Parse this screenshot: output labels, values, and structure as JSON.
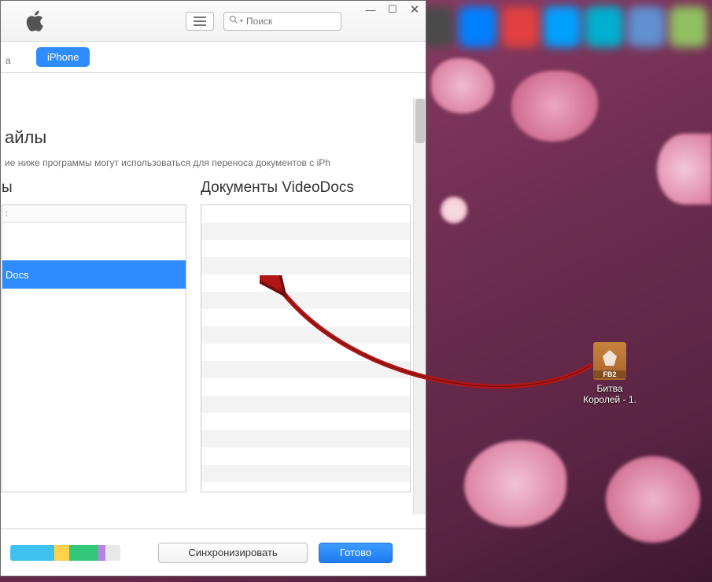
{
  "window": {
    "search_placeholder": "Поиск",
    "controls": {
      "min": "—",
      "max": "☐",
      "close": "✕"
    }
  },
  "breadcrumb_partial": "а",
  "tab": {
    "iphone": "iPhone"
  },
  "section": {
    "title_partial": "айлы",
    "description_partial": "ие ниже программы могут использоваться для переноса документов с iPh"
  },
  "apps_panel": {
    "title_partial": "ы",
    "header_partial": ":",
    "selected_app": "Docs"
  },
  "docs_panel": {
    "title": "Документы VideoDocs"
  },
  "buttons": {
    "sync": "Синхронизировать",
    "done": "Готово"
  },
  "desktop_file": {
    "badge": "FB2",
    "name": "Битва\nКоролей - 1."
  },
  "colors": {
    "accent_blue": "#2f8cff",
    "done_blue": "#1e7bf0"
  }
}
